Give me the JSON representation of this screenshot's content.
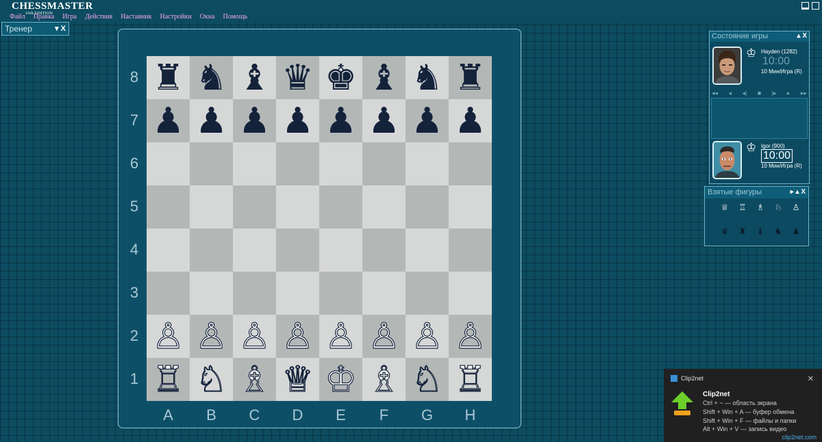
{
  "app": {
    "logo_line1": "CHESSMASTER",
    "logo_line2": "10th EDITION"
  },
  "menu": [
    "Файл",
    "Правка",
    "Игра",
    "Действия",
    "Наставник",
    "Настройки",
    "Окна",
    "Помощь"
  ],
  "trainer": {
    "title": "Тренер",
    "controls": "▾ X"
  },
  "board": {
    "ranks": [
      "8",
      "7",
      "6",
      "5",
      "4",
      "3",
      "2",
      "1"
    ],
    "files": [
      "A",
      "B",
      "C",
      "D",
      "E",
      "F",
      "G",
      "H"
    ],
    "position": [
      [
        "♜",
        "♞",
        "♝",
        "♛",
        "♚",
        "♝",
        "♞",
        "♜"
      ],
      [
        "♟",
        "♟",
        "♟",
        "♟",
        "♟",
        "♟",
        "♟",
        "♟"
      ],
      [
        "",
        "",
        "",
        "",
        "",
        "",
        "",
        ""
      ],
      [
        "",
        "",
        "",
        "",
        "",
        "",
        "",
        ""
      ],
      [
        "",
        "",
        "",
        "",
        "",
        "",
        "",
        ""
      ],
      [
        "",
        "",
        "",
        "",
        "",
        "",
        "",
        ""
      ],
      [
        "♙",
        "♙",
        "♙",
        "♙",
        "♙",
        "♙",
        "♙",
        "♙"
      ],
      [
        "♖",
        "♘",
        "♗",
        "♕",
        "♔",
        "♗",
        "♘",
        "♖"
      ]
    ],
    "light_color": "#d6d8d7",
    "dark_color": "#b3b8b7"
  },
  "game_status": {
    "title": "Состояние игры",
    "controls": "▴ X",
    "top_player": {
      "name": "Hayden (1282)",
      "time": "10:00",
      "mode": "10 Мин/Игра (R)"
    },
    "bottom_player": {
      "name": "Igor (900)",
      "time": "10:00",
      "mode": "10 Мин/Игра (R)"
    },
    "nav_buttons": [
      "◂◂",
      "◂",
      "◂|",
      "■",
      "|▸",
      "▸",
      "▸▸"
    ]
  },
  "captured": {
    "title": "Взятые фигуры",
    "controls": "▸ ▴ X",
    "row_white": [
      "♕",
      "♖",
      "♗",
      "♘",
      "♙"
    ],
    "row_black": [
      "♛",
      "♜",
      "♝",
      "♞",
      "♟"
    ]
  },
  "notification": {
    "app_name": "Clip2net",
    "title": "Clip2net",
    "lines": [
      "Ctrl + ~ — область экрана",
      "Shift + Win + A — буфер обмена",
      "Shift + Win + F — файлы и папки",
      "Alt + Win + V — запись видео"
    ],
    "brand": "clip2net.com",
    "close": "✕"
  }
}
